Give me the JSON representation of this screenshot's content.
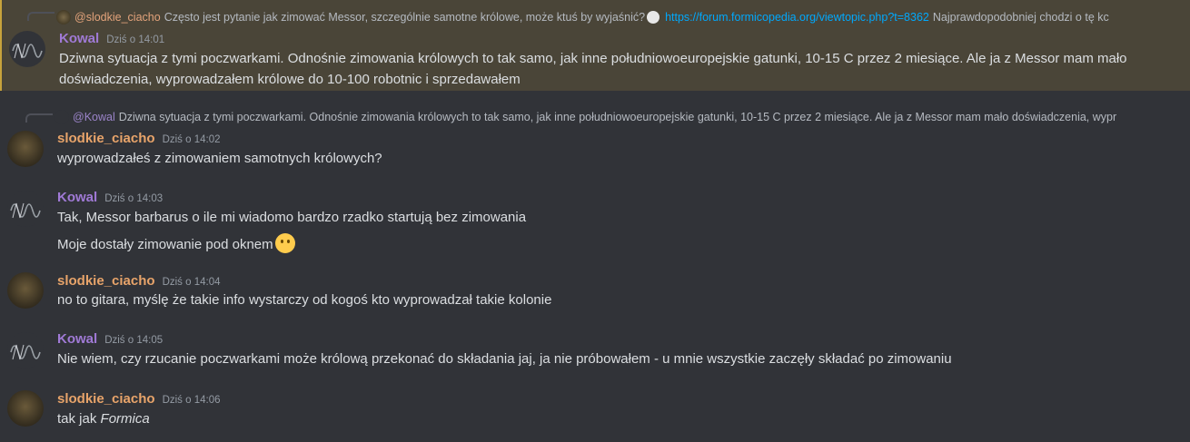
{
  "messages": [
    {
      "author": "Kowal",
      "timestamp": "Dziś o 14:01",
      "reply": {
        "author": "@slodkie_ciacho",
        "text_before": "Często jest pytanie jak zimować Messor, szczególnie samotne królowe, może ktuś by wyjaśnić?",
        "link": "https://forum.formicopedia.org/viewtopic.php?t=8362",
        "text_after": "Najprawdopodobniej chodzi o tę kc"
      },
      "lines": [
        "Dziwna sytuacja z tymi poczwarkami. Odnośnie zimowania królowych to tak samo, jak inne południowoeuropejskie gatunki, 10-15 C przez 2 miesiące. Ale ja z Messor mam mało",
        "doświadczenia, wyprowadzałem królowe do 10-100 robotnic i sprzedawałem"
      ]
    },
    {
      "author": "slodkie_ciacho",
      "timestamp": "Dziś o 14:02",
      "reply": {
        "author": "@Kowal",
        "text": "Dziwna sytuacja z tymi poczwarkami. Odnośnie zimowania królowych to tak samo, jak inne południowoeuropejskie gatunki, 10-15 C przez 2 miesiące. Ale ja z Messor mam mało doświadczenia, wypr"
      },
      "lines": [
        "wyprowadzałeś z zimowaniem samotnych królowych?"
      ]
    },
    {
      "author": "Kowal",
      "timestamp": "Dziś o 14:03",
      "lines": [
        "Tak, Messor barbarus o ile mi wiadomo bardzo rzadko startują bez zimowania",
        "Moje dostały zimowanie pod oknem"
      ]
    },
    {
      "author": "slodkie_ciacho",
      "timestamp": "Dziś o 14:04",
      "lines": [
        "no to gitara, myślę że takie info wystarczy od kogoś kto wyprowadzał takie kolonie"
      ]
    },
    {
      "author": "Kowal",
      "timestamp": "Dziś o 14:05",
      "lines": [
        "Nie wiem, czy rzucanie poczwarkami może królową przekonać do składania jaj, ja nie próbowałem - u mnie wszystkie zaczęły składać po zimowaniu"
      ]
    },
    {
      "author": "slodkie_ciacho",
      "timestamp": "Dziś o 14:06",
      "lines_parts": {
        "plain": "tak jak ",
        "italic": "Formica"
      }
    }
  ],
  "colors": {
    "background": "#313338",
    "highlight": "#4a4538",
    "kowal": "#a07ad6",
    "slodkie": "#e8a46a",
    "link": "#00a8fc"
  },
  "icons": {
    "emoji": "slightly-smiling-face-icon"
  }
}
